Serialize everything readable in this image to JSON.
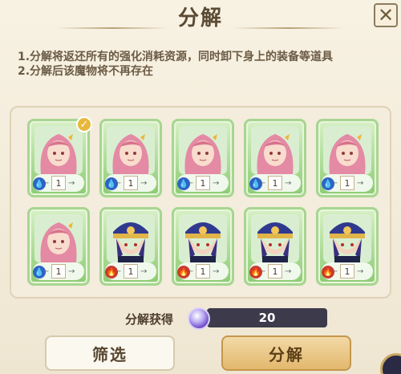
{
  "window": {
    "title": "分解",
    "close_icon": "close-icon"
  },
  "description": {
    "line1": "1.分解将返还所有的强化消耗资源，同时卸下身上的装备等道具",
    "line2": "2.分解后该魔物将不再存在"
  },
  "colors": {
    "background": "#f3ecdc",
    "card_border": "#a7d691",
    "water": "#2f63c3",
    "fire": "#c83a2e",
    "accent_gold": "#e3b86e",
    "reward_box": "#3c3a4b"
  },
  "cards": [
    {
      "element": "water",
      "level": "1",
      "selected": true,
      "portrait": "pink-hair-elf"
    },
    {
      "element": "water",
      "level": "1",
      "selected": false,
      "portrait": "pink-hair-elf"
    },
    {
      "element": "water",
      "level": "1",
      "selected": false,
      "portrait": "pink-hair-elf"
    },
    {
      "element": "water",
      "level": "1",
      "selected": false,
      "portrait": "pink-hair-elf"
    },
    {
      "element": "water",
      "level": "1",
      "selected": false,
      "portrait": "pink-hair-elf"
    },
    {
      "element": "water",
      "level": "1",
      "selected": false,
      "portrait": "pink-hair-elf"
    },
    {
      "element": "fire",
      "level": "1",
      "selected": false,
      "portrait": "blue-hat-officer"
    },
    {
      "element": "fire",
      "level": "1",
      "selected": false,
      "portrait": "blue-hat-officer"
    },
    {
      "element": "fire",
      "level": "1",
      "selected": false,
      "portrait": "blue-hat-officer"
    },
    {
      "element": "fire",
      "level": "1",
      "selected": false,
      "portrait": "blue-hat-officer"
    }
  ],
  "reward": {
    "label": "分解获得",
    "value": "20",
    "icon": "crystal-orb-icon"
  },
  "buttons": {
    "filter_label": "筛选",
    "decompose_label": "分解"
  }
}
